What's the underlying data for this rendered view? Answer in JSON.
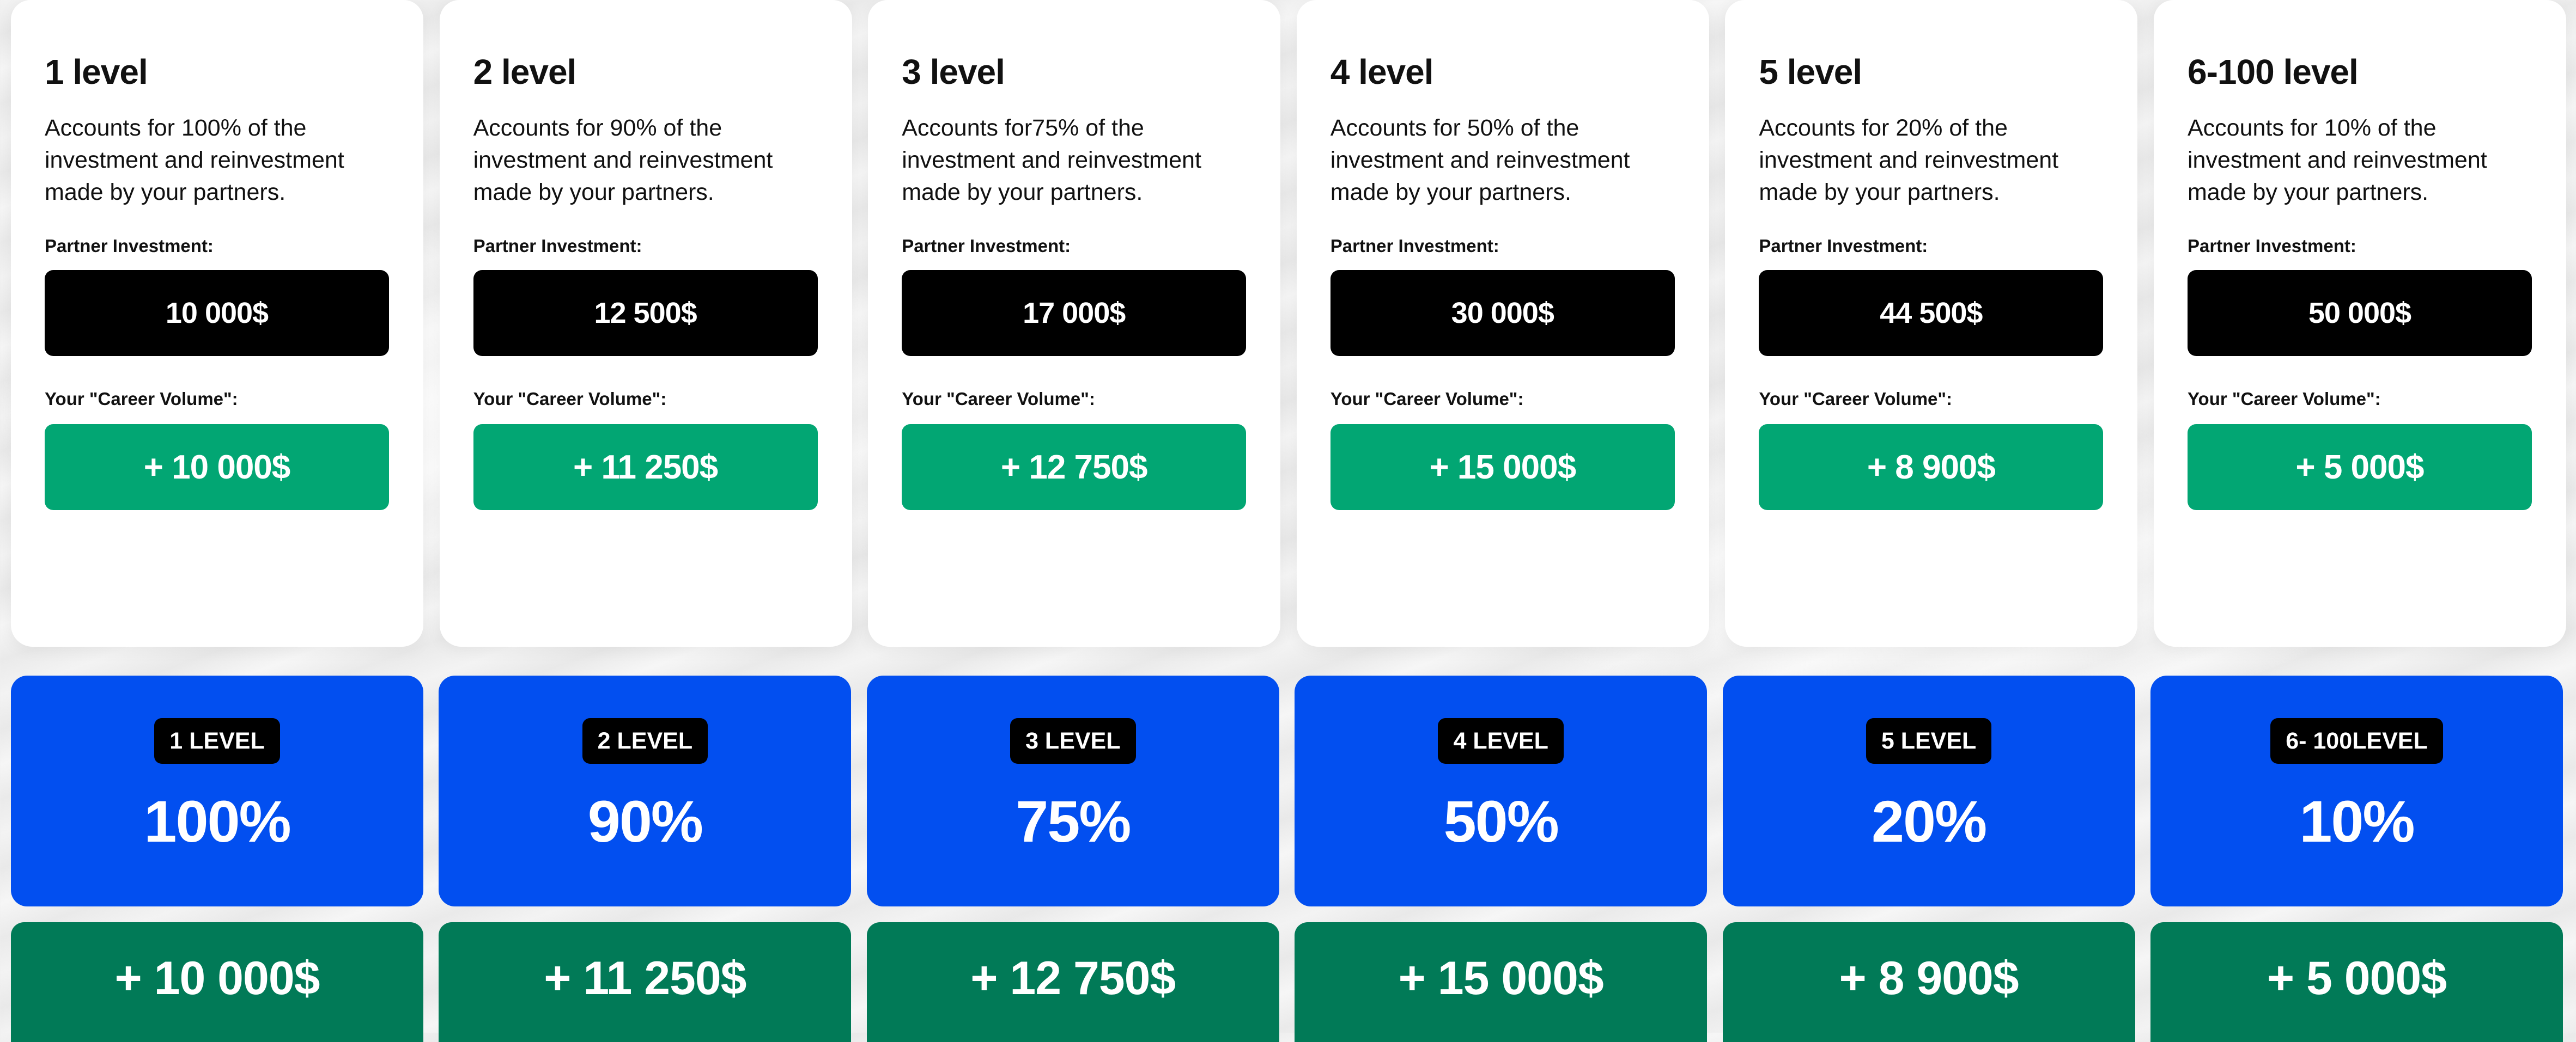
{
  "cards": [
    {
      "title": "1 level",
      "description": "Accounts for 100% of the investment and reinvestment made by your partners.",
      "investment_label": "Partner Investment:",
      "investment_value": "10 000$",
      "career_label": "Your \"Career Volume\":",
      "career_value": "+ 10 000$"
    },
    {
      "title": "2 level",
      "description": "Accounts for 90% of the investment and reinvestment made by your partners.",
      "investment_label": "Partner Investment:",
      "investment_value": "12 500$",
      "career_label": "Your \"Career Volume\":",
      "career_value": "+ 11 250$"
    },
    {
      "title": "3 level",
      "description": "Accounts for75% of the investment and reinvestment made by your partners.",
      "investment_label": "Partner Investment:",
      "investment_value": "17 000$",
      "career_label": "Your \"Career Volume\":",
      "career_value": "+ 12 750$"
    },
    {
      "title": "4 level",
      "description": "Accounts for 50% of the investment and reinvestment made by your partners.",
      "investment_label": "Partner Investment:",
      "investment_value": "30 000$",
      "career_label": "Your \"Career Volume\":",
      "career_value": "+ 15 000$"
    },
    {
      "title": "5 level",
      "description": "Accounts for 20% of the investment and reinvestment made by your partners.",
      "investment_label": "Partner Investment:",
      "investment_value": "44 500$",
      "career_label": "Your \"Career Volume\":",
      "career_value": "+ 8 900$"
    },
    {
      "title": "6-100 level",
      "description": "Accounts for 10% of the investment and reinvestment made by your partners.",
      "investment_label": "Partner Investment:",
      "investment_value": "50 000$",
      "career_label": "Your \"Career Volume\":",
      "career_value": "+ 5 000$"
    }
  ],
  "percent_tiles": [
    {
      "badge": "1 LEVEL",
      "percent": "100%"
    },
    {
      "badge": "2 LEVEL",
      "percent": "90%"
    },
    {
      "badge": "3 LEVEL",
      "percent": "75%"
    },
    {
      "badge": "4 LEVEL",
      "percent": "50%"
    },
    {
      "badge": "5 LEVEL",
      "percent": "20%"
    },
    {
      "badge": "6- 100LEVEL",
      "percent": "10%"
    }
  ],
  "result_tiles": [
    {
      "value": "+ 10 000$"
    },
    {
      "value": "+ 11 250$"
    },
    {
      "value": "+ 12 750$"
    },
    {
      "value": "+ 15 000$"
    },
    {
      "value": "+ 8 900$"
    },
    {
      "value": "+ 5 000$"
    }
  ],
  "colors": {
    "investment_box": "#000000",
    "career_box": "#02a673",
    "percent_tile": "#024ff0",
    "result_tile": "#017a57",
    "badge": "#000000"
  }
}
